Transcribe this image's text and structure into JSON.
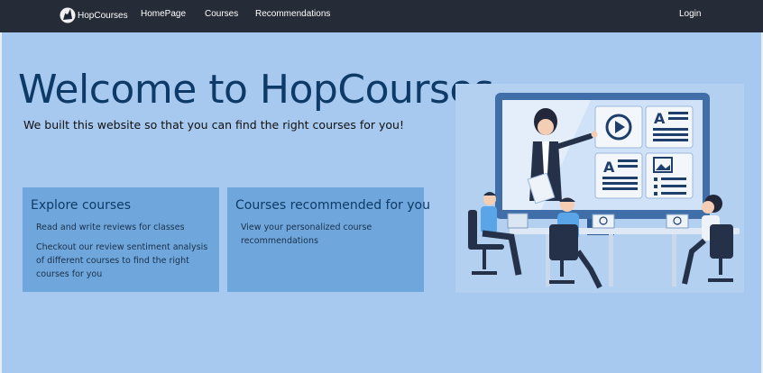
{
  "nav": {
    "brand": "HopCourses",
    "links": [
      "HomePage",
      "Courses",
      "Recommendations"
    ],
    "login": "Login"
  },
  "hero": {
    "title": "Welcome to HopCourses",
    "subtitle": "We built this website so that you can find the right courses for you!"
  },
  "cards": [
    {
      "title": "Explore courses",
      "lines": [
        "Read and write reviews for classes",
        "Checkout our review sentiment analysis of different courses to find the right courses for you"
      ]
    },
    {
      "title": "Courses recommended for you",
      "lines": [
        "View your personalized course recommendations"
      ]
    }
  ],
  "colors": {
    "navbar": "#252b37",
    "background": "#a8c9ef",
    "card": "#6fa7dc",
    "title": "#0d3a66"
  },
  "icons": [
    "hopcourses-logo-icon",
    "classroom-illustration"
  ]
}
